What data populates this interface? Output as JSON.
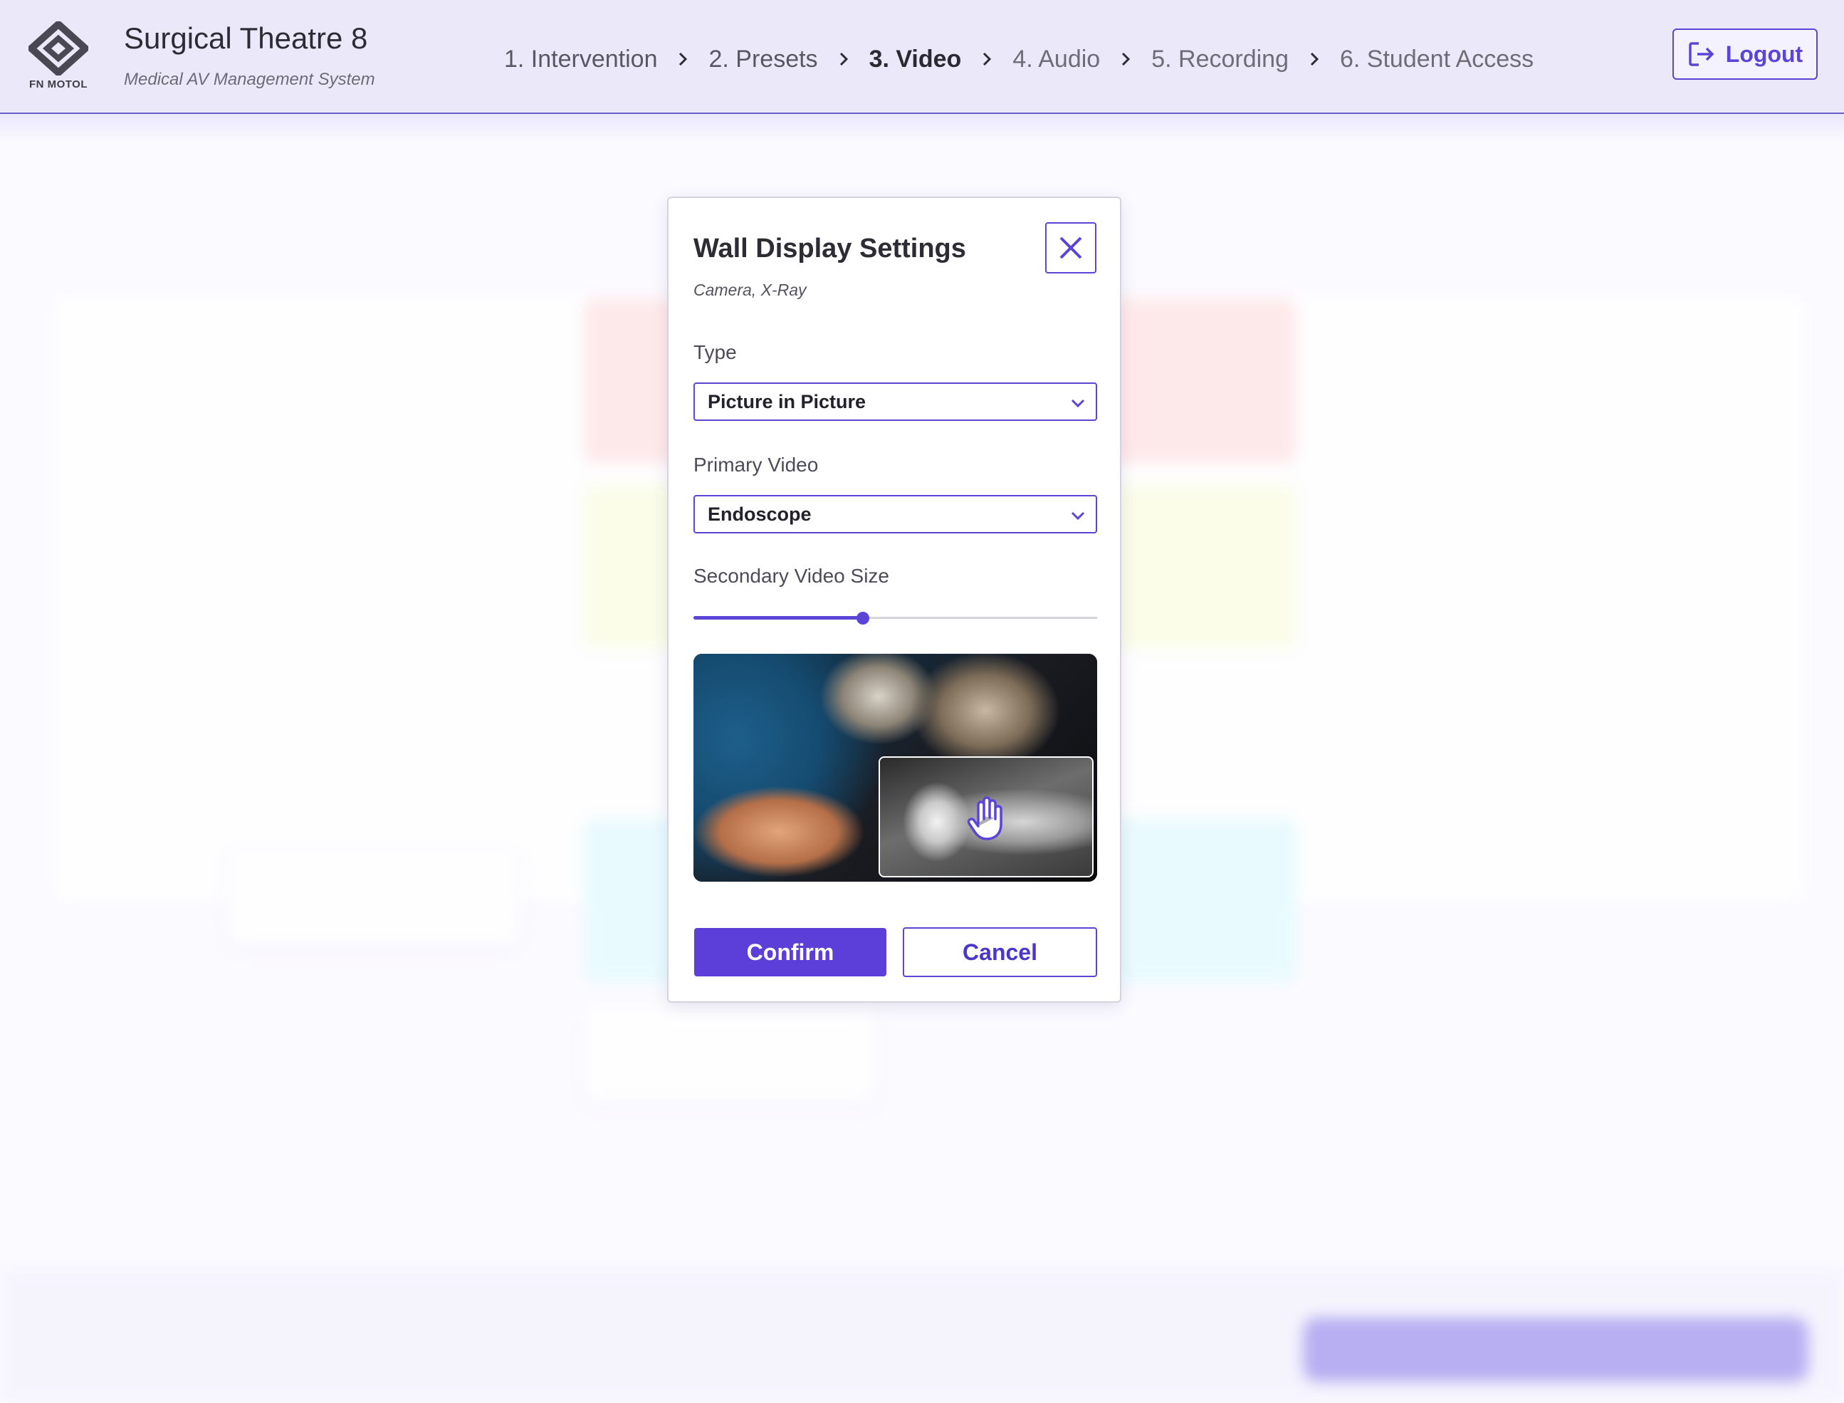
{
  "header": {
    "logo_text": "FN MOTOL",
    "title": "Surgical Theatre 8",
    "subtitle": "Medical AV Management System",
    "steps": [
      {
        "label": "1. Intervention",
        "state": "done"
      },
      {
        "label": "2. Presets",
        "state": "done"
      },
      {
        "label": "3. Video",
        "state": "current"
      },
      {
        "label": "4. Audio",
        "state": "future"
      },
      {
        "label": "5. Recording",
        "state": "future"
      },
      {
        "label": "6. Student Access",
        "state": "future"
      }
    ],
    "logout_label": "Logout"
  },
  "modal": {
    "title": "Wall Display Settings",
    "subtitle": "Camera, X-Ray",
    "type_label": "Type",
    "type_value": "Picture in Picture",
    "primary_label": "Primary Video",
    "primary_value": "Endoscope",
    "secondary_size_label": "Secondary Video Size",
    "secondary_size_fraction": 0.42,
    "preview": {
      "main_source": "camera",
      "pip_source": "x-ray",
      "pip_icon": "hand-grab-icon"
    },
    "confirm_label": "Confirm",
    "cancel_label": "Cancel"
  },
  "colors": {
    "accent": "#5b45d6",
    "header_bg": "#ebe8fa",
    "page_bg": "#fbfaff"
  }
}
